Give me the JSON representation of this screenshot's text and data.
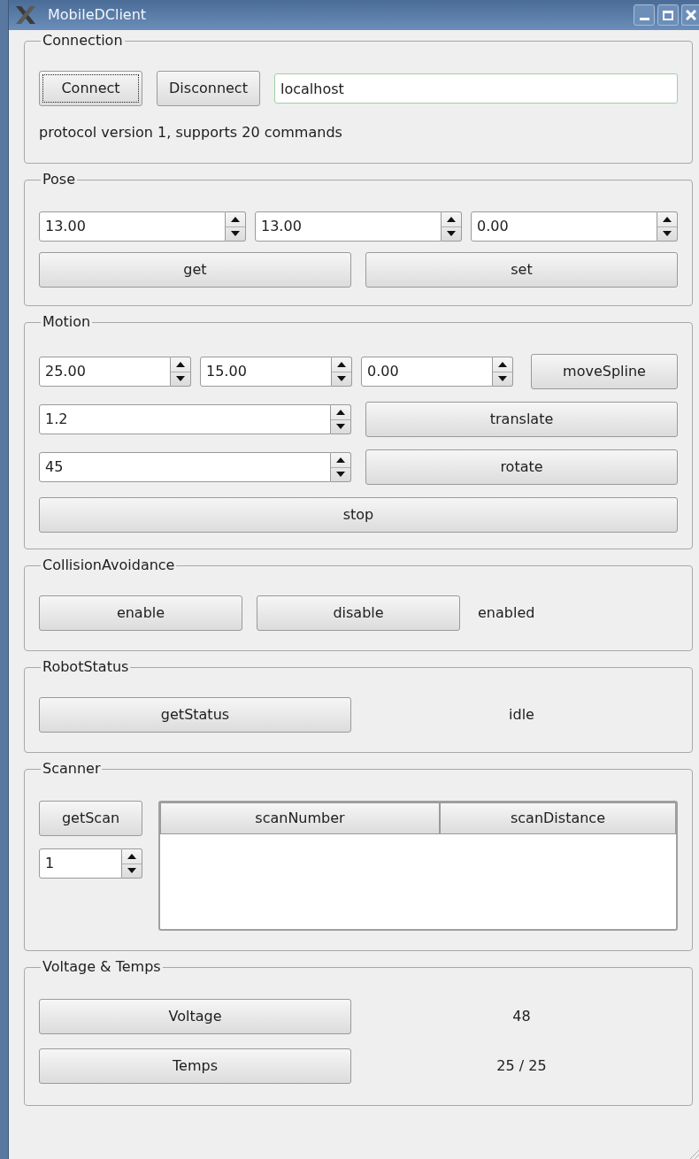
{
  "window": {
    "title": "MobileDClient"
  },
  "connection": {
    "title": "Connection",
    "buttons": [
      {
        "label": "Connect",
        "focused": true
      },
      {
        "label": "Disconnect",
        "focused": false
      }
    ],
    "host_field": {
      "value": "localhost"
    },
    "status": "protocol version 1, supports 20 commands"
  },
  "pose": {
    "title": "Pose",
    "spinboxes": [
      "13.00",
      "13.00",
      "0.00"
    ],
    "buttons": [
      "get",
      "set"
    ]
  },
  "motion": {
    "title": "Motion",
    "spline": {
      "spinboxes": [
        "25.00",
        "15.00",
        "0.00"
      ],
      "button": "moveSpline"
    },
    "translate": {
      "spinbox": "1.2",
      "button": "translate"
    },
    "rotate": {
      "spinbox": "45",
      "button": "rotate"
    },
    "stop_button": "stop"
  },
  "collision_avoidance": {
    "title": "CollisionAvoidance",
    "buttons": [
      "enable",
      "disable"
    ],
    "status": "enabled"
  },
  "robot_status": {
    "title": "RobotStatus",
    "button": "getStatus",
    "status": "idle"
  },
  "scanner": {
    "title": "Scanner",
    "button": "getScan",
    "spinbox": "1",
    "table": {
      "columns": [
        "scanNumber",
        "scanDistance"
      ]
    }
  },
  "voltage_temps": {
    "title": "Voltage & Temps",
    "rows": [
      {
        "button": "Voltage",
        "value": "48"
      },
      {
        "button": "Temps",
        "value": "25 / 25"
      }
    ]
  }
}
